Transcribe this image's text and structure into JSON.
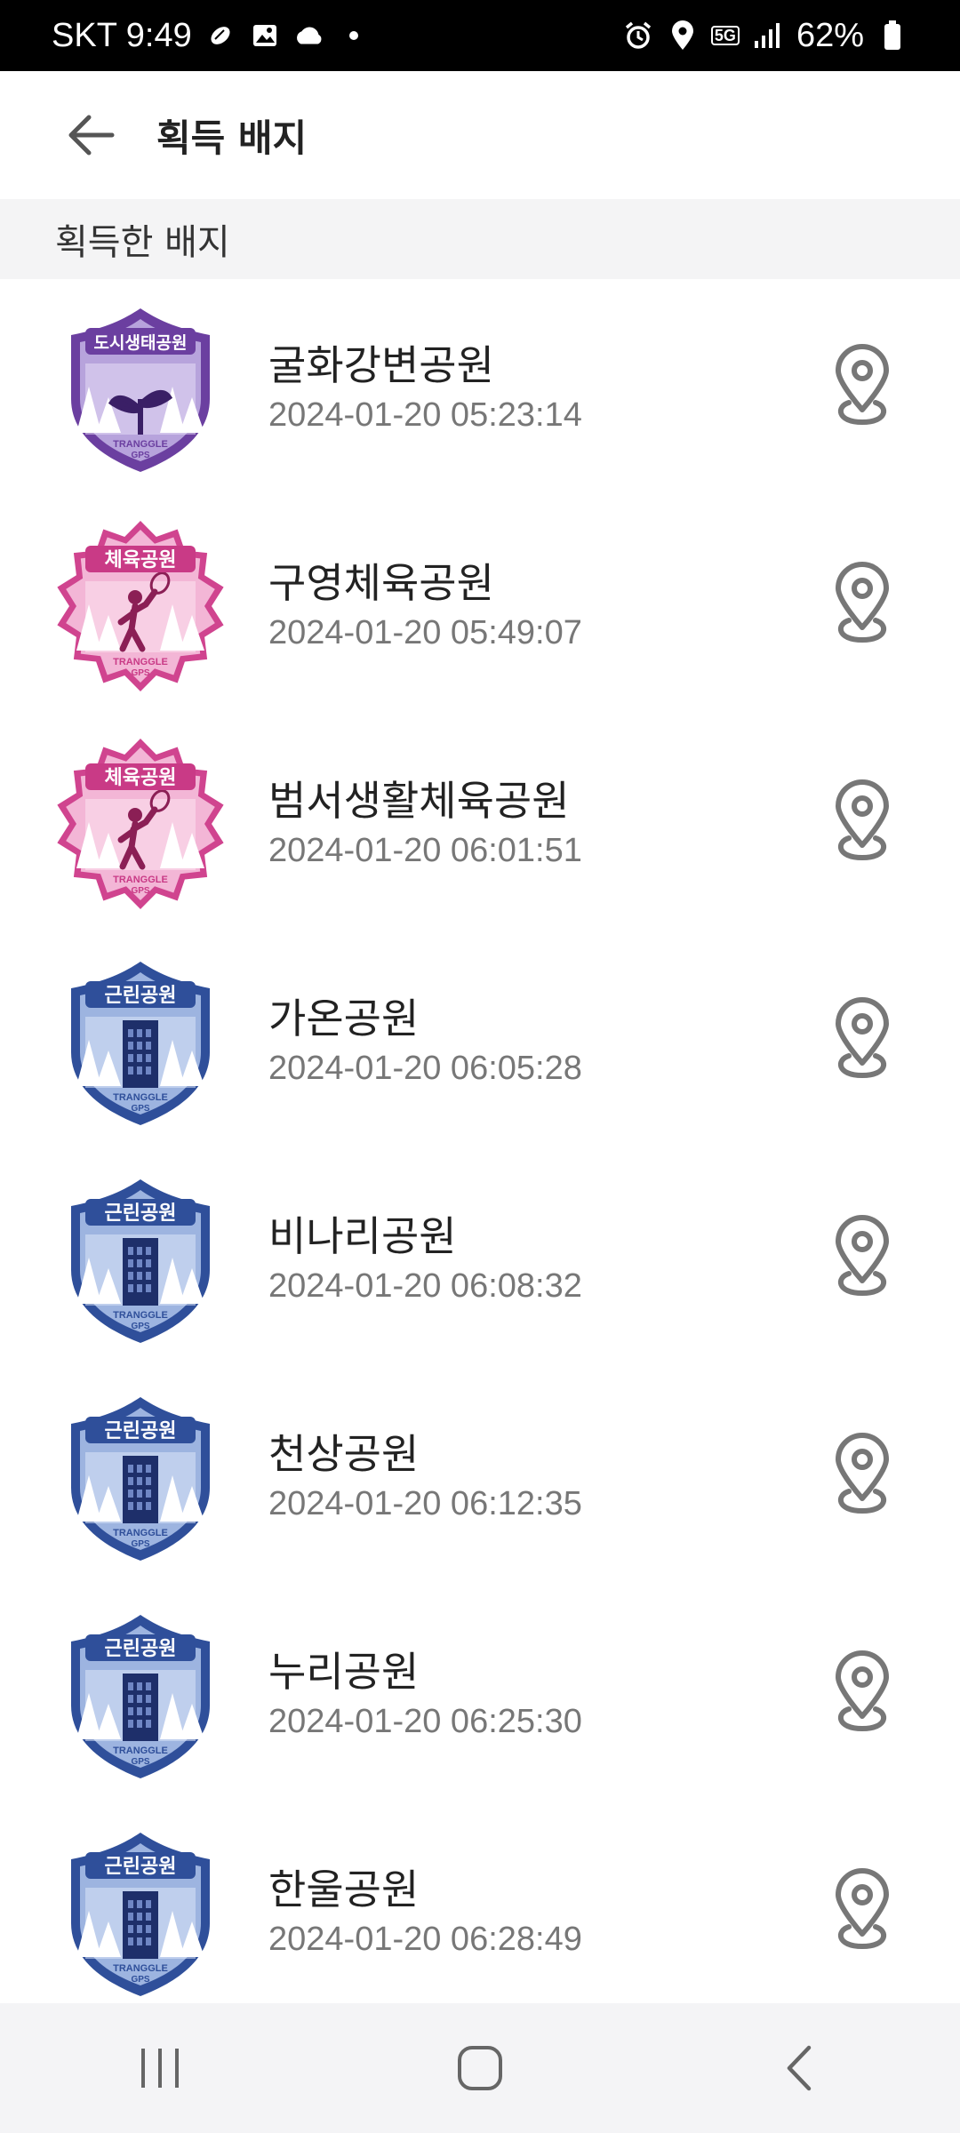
{
  "status_bar": {
    "carrier_time": "SKT 9:49",
    "network": "5G",
    "battery": "62%"
  },
  "app_bar": {
    "title": "획득 배지"
  },
  "section": {
    "title": "획득한 배지"
  },
  "badge_labels": {
    "ecological": "도시생태공원",
    "sports": "체육공원",
    "neighborhood": "근린공원",
    "brand_line1": "TRANGGLE",
    "brand_line2": "GPS"
  },
  "badges": [
    {
      "name": "굴화강변공원",
      "date": "2024-01-20 05:23:14",
      "type": "ecological",
      "type_label": "도시생태공원",
      "color": "#6b3fa0"
    },
    {
      "name": "구영체육공원",
      "date": "2024-01-20 05:49:07",
      "type": "sports",
      "type_label": "체육공원",
      "color": "#d0448f"
    },
    {
      "name": "범서생활체육공원",
      "date": "2024-01-20 06:01:51",
      "type": "sports",
      "type_label": "체육공원",
      "color": "#d0448f"
    },
    {
      "name": "가온공원",
      "date": "2024-01-20 06:05:28",
      "type": "neighborhood",
      "type_label": "근린공원",
      "color": "#2f4f9a"
    },
    {
      "name": "비나리공원",
      "date": "2024-01-20 06:08:32",
      "type": "neighborhood",
      "type_label": "근린공원",
      "color": "#2f4f9a"
    },
    {
      "name": "천상공원",
      "date": "2024-01-20 06:12:35",
      "type": "neighborhood",
      "type_label": "근린공원",
      "color": "#2f4f9a"
    },
    {
      "name": "누리공원",
      "date": "2024-01-20 06:25:30",
      "type": "neighborhood",
      "type_label": "근린공원",
      "color": "#2f4f9a"
    },
    {
      "name": "한울공원",
      "date": "2024-01-20 06:28:49",
      "type": "neighborhood",
      "type_label": "근린공원",
      "color": "#2f4f9a"
    }
  ],
  "icons": {
    "back": "arrow-left-icon",
    "map": "map-pin-icon",
    "nav_recents": "recents-icon",
    "nav_home": "home-icon",
    "nav_back": "back-icon"
  }
}
